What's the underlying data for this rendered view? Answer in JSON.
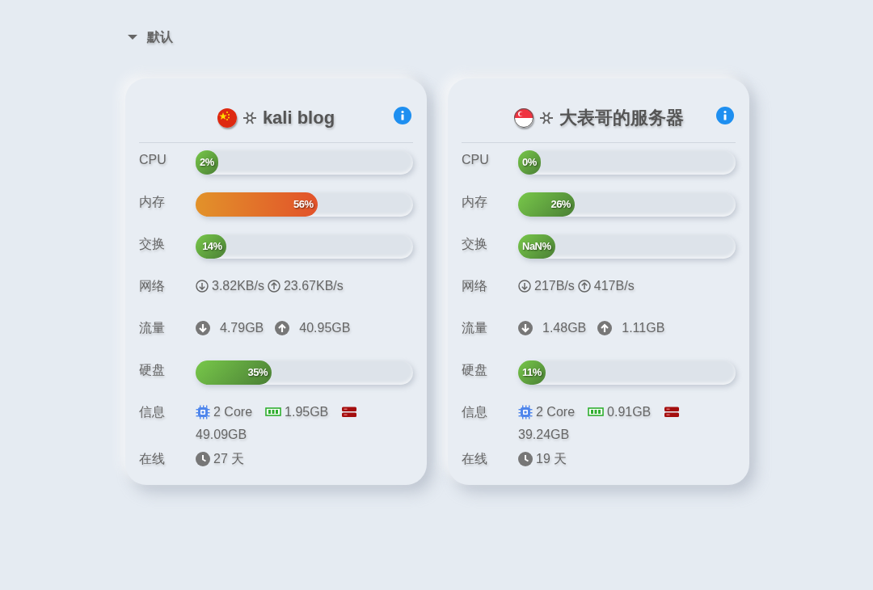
{
  "group": {
    "label": "默认",
    "expanded": true
  },
  "servers": [
    {
      "flag": {
        "kind": "cn"
      },
      "name": "kali blog",
      "rows": [
        {
          "kind": "bar",
          "label": "CPU",
          "level": 0.02,
          "reading": "2%"
        },
        {
          "kind": "bar",
          "label": "内存",
          "level": 0.56,
          "reading": "56%"
        },
        {
          "kind": "bar",
          "label": "交换",
          "level": 0.14,
          "reading": "14%"
        },
        {
          "kind": "rates",
          "label": "网络",
          "down": "3.82KB/s",
          "up": "23.67KB/s"
        },
        {
          "kind": "traffic",
          "label": "流量",
          "down": "4.79GB",
          "up": "40.95GB"
        },
        {
          "kind": "bar",
          "label": "硬盘",
          "level": 0.35,
          "reading": "35%"
        },
        {
          "kind": "info",
          "label": "信息",
          "cores": "2 Core",
          "memory": "1.95GB",
          "disk": "49.09GB"
        },
        {
          "kind": "uptime",
          "label": "在线",
          "value": "27 天"
        }
      ]
    },
    {
      "flag": {
        "kind": "sg"
      },
      "name": "大表哥的服务器",
      "rows": [
        {
          "kind": "bar",
          "label": "CPU",
          "level": 0,
          "reading": "0%"
        },
        {
          "kind": "bar",
          "label": "内存",
          "level": 0.26,
          "reading": "26%"
        },
        {
          "kind": "bar",
          "label": "交换",
          "level": 0,
          "reading": "NaN%"
        },
        {
          "kind": "rates",
          "label": "网络",
          "down": "217B/s",
          "up": "417B/s"
        },
        {
          "kind": "traffic",
          "label": "流量",
          "down": "1.48GB",
          "up": "1.11GB"
        },
        {
          "kind": "bar",
          "label": "硬盘",
          "level": 0.11,
          "reading": "11%"
        },
        {
          "kind": "info",
          "label": "信息",
          "cores": "2 Core",
          "memory": "0.91GB",
          "disk": "39.24GB"
        },
        {
          "kind": "uptime",
          "label": "在线",
          "value": "19 天"
        }
      ]
    }
  ]
}
